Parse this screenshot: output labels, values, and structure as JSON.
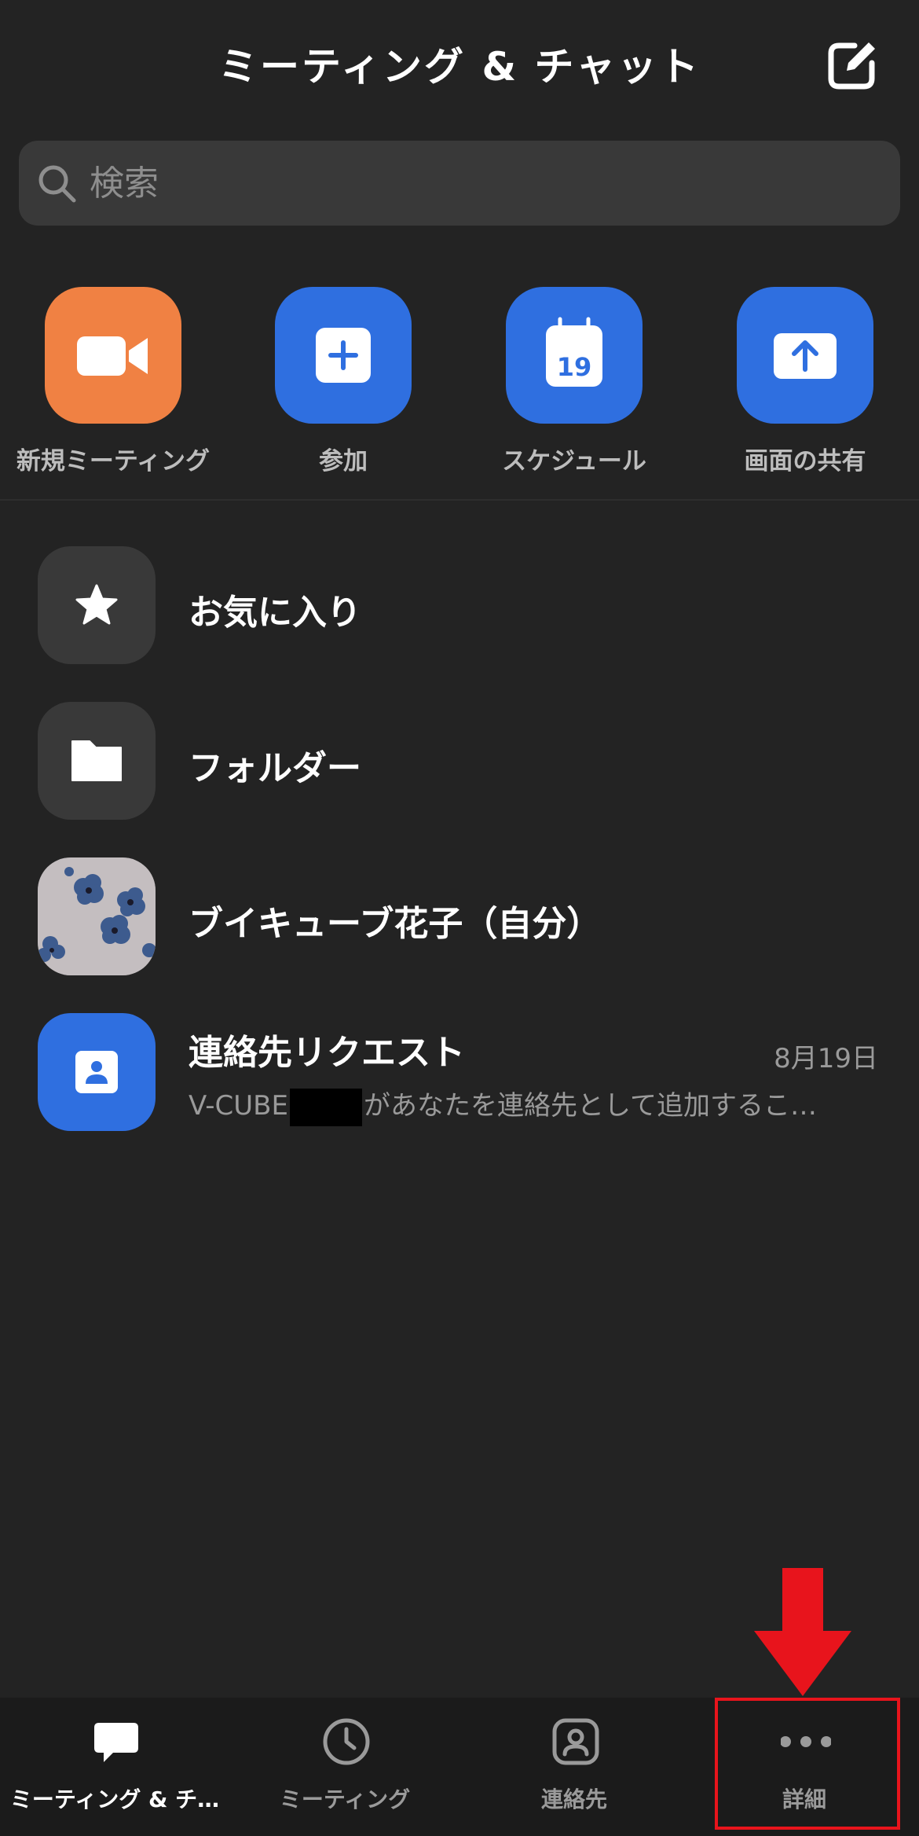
{
  "header": {
    "title": "ミーティング & チャット",
    "compose_icon": "edit-icon"
  },
  "search": {
    "placeholder": "検索"
  },
  "quick_actions": [
    {
      "label": "新規ミーティング",
      "icon": "video-camera-icon",
      "color": "#f08143"
    },
    {
      "label": "参加",
      "icon": "plus-icon",
      "color": "#2f6fe0"
    },
    {
      "label": "スケジュール",
      "icon": "calendar-icon",
      "color": "#2f6fe0",
      "calendar_day": "19"
    },
    {
      "label": "画面の共有",
      "icon": "share-screen-icon",
      "color": "#2f6fe0"
    }
  ],
  "list": [
    {
      "title": "お気に入り",
      "icon": "star-icon"
    },
    {
      "title": "フォルダー",
      "icon": "folder-icon"
    },
    {
      "title": "ブイキューブ花子（自分）",
      "icon": "avatar"
    },
    {
      "title": "連絡先リクエスト",
      "date": "8月19日",
      "subtitle_prefix": "V-CUBE",
      "subtitle_suffix": "があなたを連絡先として追加するこ…",
      "icon": "contact-card-icon"
    }
  ],
  "tabs": [
    {
      "label": "ミーティング & チ…",
      "icon": "chat-bubble-icon",
      "active": true
    },
    {
      "label": "ミーティング",
      "icon": "clock-icon",
      "active": false
    },
    {
      "label": "連絡先",
      "icon": "contact-icon",
      "active": false
    },
    {
      "label": "詳細",
      "icon": "more-icon",
      "active": false
    }
  ],
  "colors": {
    "background": "#232323",
    "accent_blue": "#2f6fe0",
    "accent_orange": "#f08143",
    "annotation_red": "#e8141c"
  }
}
